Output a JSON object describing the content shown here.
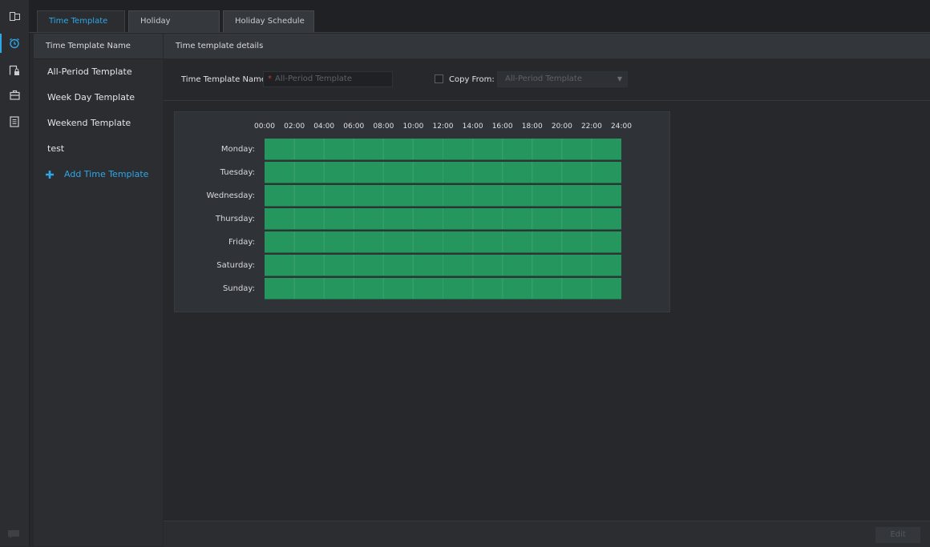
{
  "tabs": [
    {
      "label": "Time Template",
      "active": true
    },
    {
      "label": "Holiday",
      "active": false
    },
    {
      "label": "Holiday Schedule",
      "active": false
    }
  ],
  "rail_icons": [
    "dual-window-icon",
    "alarm-clock-icon",
    "device-lock-icon",
    "briefcase-icon",
    "document-list-icon"
  ],
  "left_panel": {
    "header": "Time Template Name",
    "items": [
      "All-Period Template",
      "Week Day Template",
      "Weekend Template",
      "test"
    ],
    "add_label": "Add Time Template"
  },
  "details": {
    "header": "Time template details",
    "name_label": "Time Template Name:",
    "name_placeholder": "All-Period Template",
    "copy_label": "Copy From:",
    "copy_value": "All-Period Template"
  },
  "schedule": {
    "hours": [
      "00:00",
      "02:00",
      "04:00",
      "06:00",
      "08:00",
      "10:00",
      "12:00",
      "14:00",
      "16:00",
      "18:00",
      "20:00",
      "22:00",
      "24:00"
    ],
    "days": [
      {
        "label": "Monday:",
        "start": "00:00",
        "end": "24:00"
      },
      {
        "label": "Tuesday:",
        "start": "00:00",
        "end": "24:00"
      },
      {
        "label": "Wednesday:",
        "start": "00:00",
        "end": "24:00"
      },
      {
        "label": "Thursday:",
        "start": "00:00",
        "end": "24:00"
      },
      {
        "label": "Friday:",
        "start": "00:00",
        "end": "24:00"
      },
      {
        "label": "Saturday:",
        "start": "00:00",
        "end": "24:00"
      },
      {
        "label": "Sunday:",
        "start": "00:00",
        "end": "24:00"
      }
    ],
    "color": "#24965e"
  },
  "footer": {
    "edit_label": "Edit"
  },
  "colors": {
    "accent": "#2ea7e8",
    "background": "#26282b"
  }
}
